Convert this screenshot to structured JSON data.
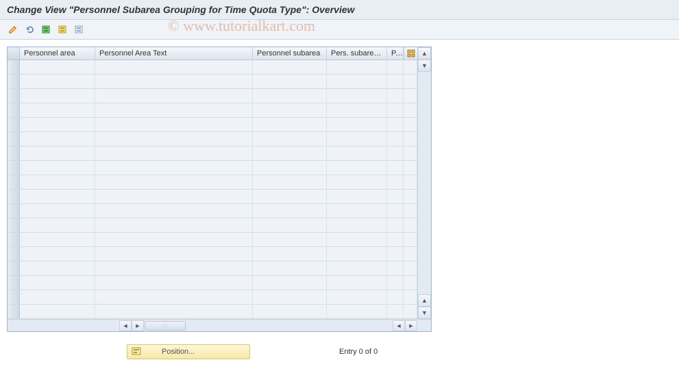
{
  "title": "Change View \"Personnel Subarea Grouping for Time Quota Type\": Overview",
  "watermark": "© www.tutorialkart.com",
  "toolbar": {
    "icons": [
      "edit-icon",
      "undo-icon",
      "select-all-icon",
      "select-block-icon",
      "deselect-all-icon"
    ]
  },
  "table": {
    "headers": {
      "c1": "Personnel area",
      "c2": "Personnel Area Text",
      "c3": "Personnel subarea",
      "c4": "Pers. subarea ...",
      "c5": "P..."
    },
    "rows": 18
  },
  "footer": {
    "position_label": "Position...",
    "entry_text": "Entry 0 of 0"
  }
}
